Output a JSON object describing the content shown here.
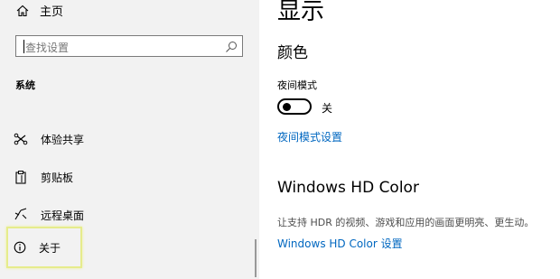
{
  "sidebar": {
    "home_label": "主页",
    "search_placeholder": "查找设置",
    "section_title": "系统",
    "items": [
      {
        "label": "体验共享",
        "icon": "shared-experiences-icon"
      },
      {
        "label": "剪贴板",
        "icon": "clipboard-icon"
      },
      {
        "label": "远程桌面",
        "icon": "remote-desktop-icon"
      },
      {
        "label": "关于",
        "icon": "info-icon"
      }
    ]
  },
  "main": {
    "title": "显示",
    "color_heading": "颜色",
    "night_light_label": "夜间模式",
    "night_light_state": "关",
    "night_light_settings_link": "夜间模式设置",
    "hd_color_heading": "Windows HD Color",
    "hd_color_desc": "让支持 HDR 的视频、游戏和应用的画面更明亮、更生动。",
    "hd_color_link": "Windows HD Color 设置"
  },
  "colors": {
    "accent_link": "#0067c0",
    "highlight_border": "#e6ec8c",
    "sidebar_bg": "#f2f2f2"
  }
}
